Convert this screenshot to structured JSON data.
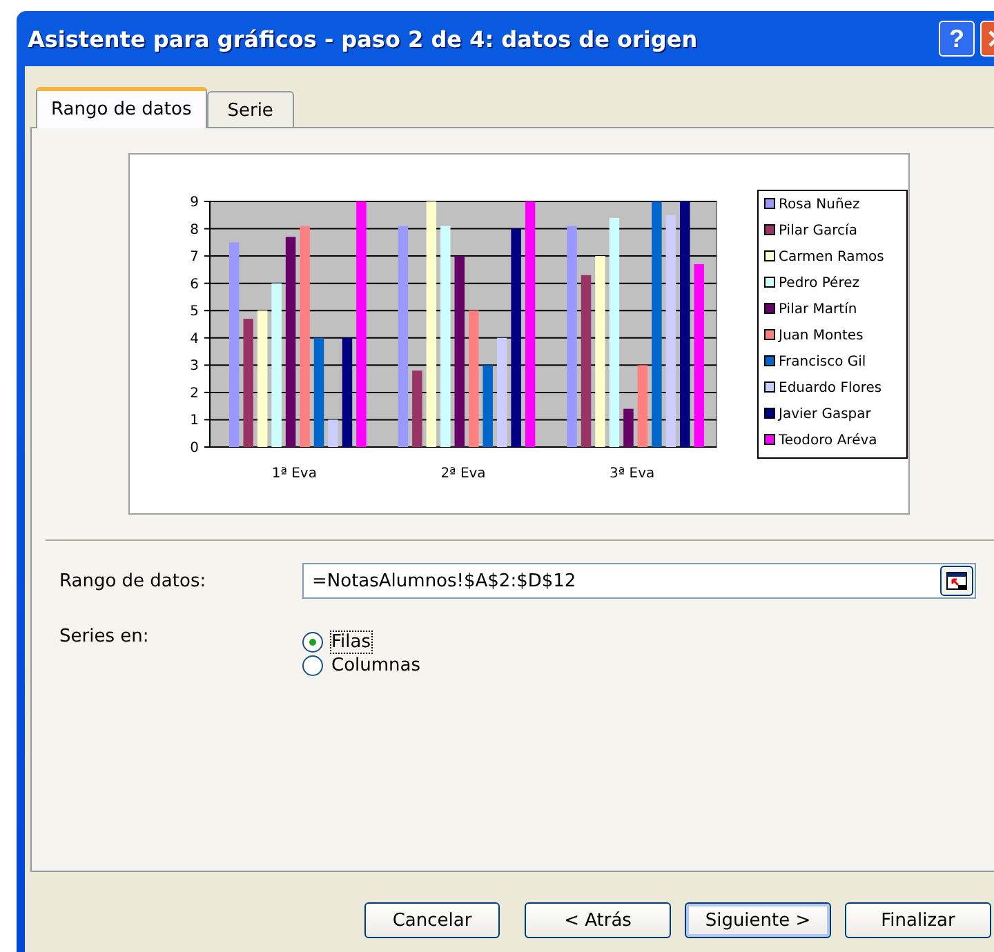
{
  "window": {
    "title": "Asistente para gráficos - paso 2 de 4: datos de origen",
    "help_button": "?"
  },
  "tabs": [
    {
      "label": "Rango de datos",
      "selected": true
    },
    {
      "label": "Serie",
      "selected": false
    }
  ],
  "chart": {
    "chart_data": {
      "type": "bar",
      "grid": true,
      "legend": "right",
      "categories": [
        "1ª Eva",
        "2ª Eva",
        "3ª Eva"
      ],
      "ylim": [
        0,
        9
      ],
      "yticks": [
        0,
        1,
        2,
        3,
        4,
        5,
        6,
        7,
        8,
        9
      ],
      "series": [
        {
          "name": "Rosa Nuñez",
          "color": "#9999ff",
          "values": [
            7.5,
            8.1,
            8.1
          ]
        },
        {
          "name": "Pilar García",
          "color": "#993366",
          "values": [
            4.7,
            2.8,
            6.3
          ]
        },
        {
          "name": "Carmen Ramos",
          "color": "#ffffcc",
          "values": [
            5,
            9,
            7
          ]
        },
        {
          "name": "Pedro Pérez",
          "color": "#ccffff",
          "values": [
            6,
            8.1,
            8.4
          ]
        },
        {
          "name": "Pilar Martín",
          "color": "#660066",
          "values": [
            7.7,
            7,
            1.4
          ]
        },
        {
          "name": "Juan Montes",
          "color": "#ff8080",
          "values": [
            8.1,
            5,
            3
          ]
        },
        {
          "name": "Francisco Gil",
          "color": "#0066cc",
          "values": [
            4,
            3,
            9
          ]
        },
        {
          "name": "Eduardo Flores",
          "color": "#ccccff",
          "values": [
            1,
            4,
            8.5
          ]
        },
        {
          "name": "Javier Gaspar",
          "color": "#000080",
          "values": [
            4,
            8,
            9
          ]
        },
        {
          "name": "Teodoro Aréva",
          "color": "#ff00ff",
          "values": [
            9,
            9,
            6.7
          ]
        }
      ]
    }
  },
  "range": {
    "label": "Rango de datos:",
    "value": "=NotasAlumnos!$A$2:$D$12"
  },
  "series_in": {
    "label": "Series en:",
    "options": [
      {
        "label": "Filas",
        "selected": true
      },
      {
        "label": "Columnas",
        "selected": false
      }
    ]
  },
  "buttons": [
    {
      "label": "Cancelar",
      "default": false
    },
    {
      "label": "< Atrás",
      "default": false
    },
    {
      "label": "Siguiente >",
      "default": true
    },
    {
      "label": "Finalizar",
      "default": false
    }
  ]
}
